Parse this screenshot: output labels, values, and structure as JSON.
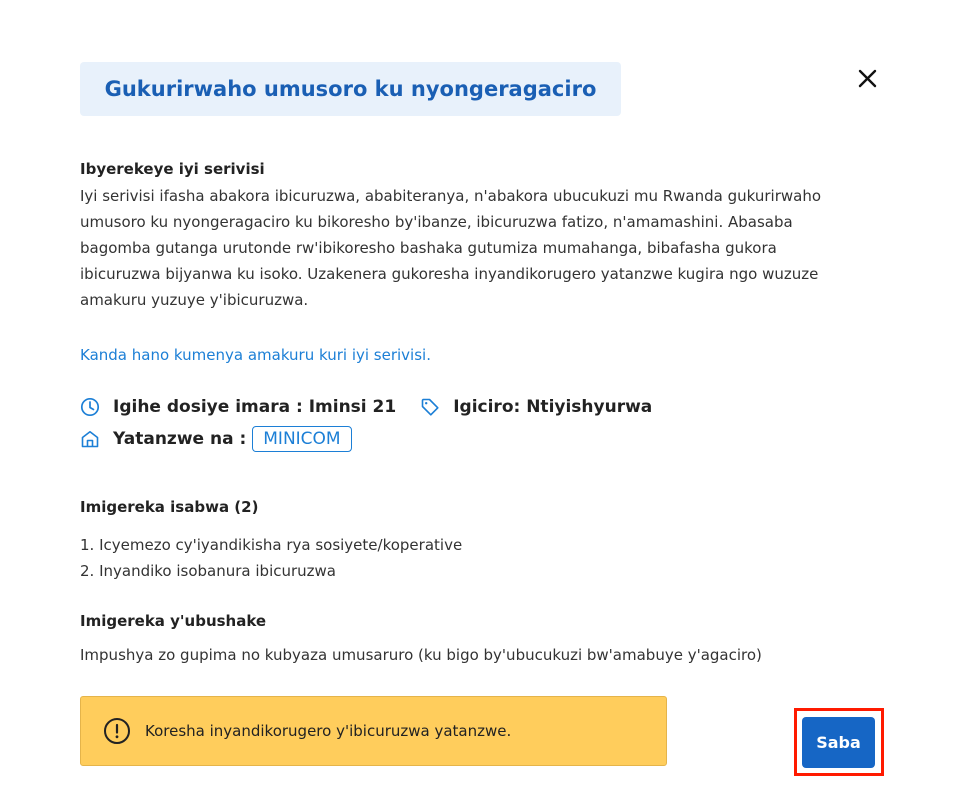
{
  "modal": {
    "title": "Gukurirwaho umusoro ku nyongeragaciro",
    "close_icon": "close-icon"
  },
  "about": {
    "heading": "Ibyerekeye iyi serivisi",
    "body": "Iyi serivisi ifasha abakora ibicuruzwa, ababiteranya, n'abakora ubucukuzi mu Rwanda gukurirwaho umusoro ku nyongeragaciro ku bikoresho by'ibanze, ibicuruzwa fatizo, n'amamashini. Abasaba bagomba gutanga urutonde rw'ibikoresho bashaka gutumiza mumahanga, bibafasha gukora ibicuruzwa bijyanwa ku isoko. Uzakenera gukoresha inyandikorugero yatanzwe kugira ngo wuzuze amakuru yuzuye y'ibicuruzwa.",
    "link": "Kanda hano kumenya amakuru kuri iyi serivisi."
  },
  "meta": {
    "processing_time": "Igihe dosiye imara : Iminsi 21",
    "processing_icon": "clock-icon",
    "price": "Igiciro: Ntiyishyurwa",
    "price_icon": "tag-icon",
    "provider_label": "Yatanzwe na :",
    "provider_icon": "building-icon",
    "provider": "MINICOM"
  },
  "required_docs": {
    "heading": "Imigereka isabwa (2)",
    "items": [
      "1. Icyemezo cy'iyandikisha rya sosiyete/koperative",
      "2. Inyandiko isobanura ibicuruzwa"
    ]
  },
  "optional_docs": {
    "heading": "Imigereka y'ubushake",
    "text": "Impushya zo gupima no kubyaza umusaruro (ku bigo by'ubucukuzi bw'amabuye y'agaciro)"
  },
  "alert": {
    "icon": "exclamation-circle-icon",
    "text": "Koresha inyandikorugero y'ibicuruzwa yatanzwe."
  },
  "actions": {
    "apply_label": "Saba"
  },
  "colors": {
    "accent": "#1666c5",
    "link": "#1c7fd6",
    "title_bg": "#e8f1fb",
    "alert_bg": "#ffcd5c",
    "highlight": "#ff1a00"
  }
}
